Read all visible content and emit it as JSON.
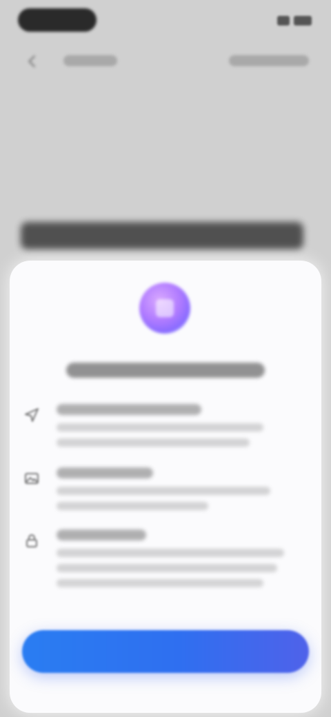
{
  "page": {
    "background": "#d0d0d0"
  },
  "status_bar": {
    "left_pill": "",
    "right_icons": [
      "signal-icon",
      "wifi-icon",
      "battery-icon"
    ]
  },
  "nav": {
    "back_icon": "chevron-left-icon",
    "left_label": "",
    "right_label": ""
  },
  "background_content": {
    "headline": ""
  },
  "sheet": {
    "icon": "sparkle-icon",
    "title": "",
    "features": [
      {
        "icon": "location-arrow-icon",
        "title": "",
        "lines": [
          "",
          ""
        ]
      },
      {
        "icon": "image-icon",
        "title": "",
        "lines": [
          "",
          ""
        ]
      },
      {
        "icon": "lock-icon",
        "title": "",
        "lines": [
          "",
          "",
          ""
        ]
      }
    ],
    "primary_button": {
      "label": "",
      "colors": [
        "#2a7df2",
        "#4f62ea"
      ]
    }
  }
}
